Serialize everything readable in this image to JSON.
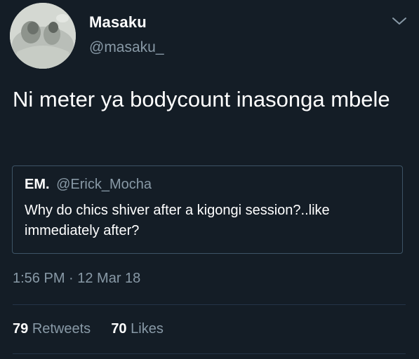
{
  "author": {
    "display_name": "Masaku",
    "handle": "@masaku_",
    "avatar_icon": "profile-photo"
  },
  "menu_icon": "chevron-down-icon",
  "tweet": {
    "text": "Ni meter ya bodycount inasonga mbele",
    "timestamp": "1:56 PM · 12 Mar 18"
  },
  "quoted_tweet": {
    "name": "EM.",
    "handle": "@Erick_Mocha",
    "text": "Why do chics shiver after a kigongi session?..like immediately after?"
  },
  "stats": {
    "retweets_count": "79",
    "retweets_label": "Retweets",
    "likes_count": "70",
    "likes_label": "Likes"
  },
  "colors": {
    "background": "#141d26",
    "secondary_text": "#8899a6",
    "border": "#3d5466",
    "primary_text": "#ffffff"
  }
}
